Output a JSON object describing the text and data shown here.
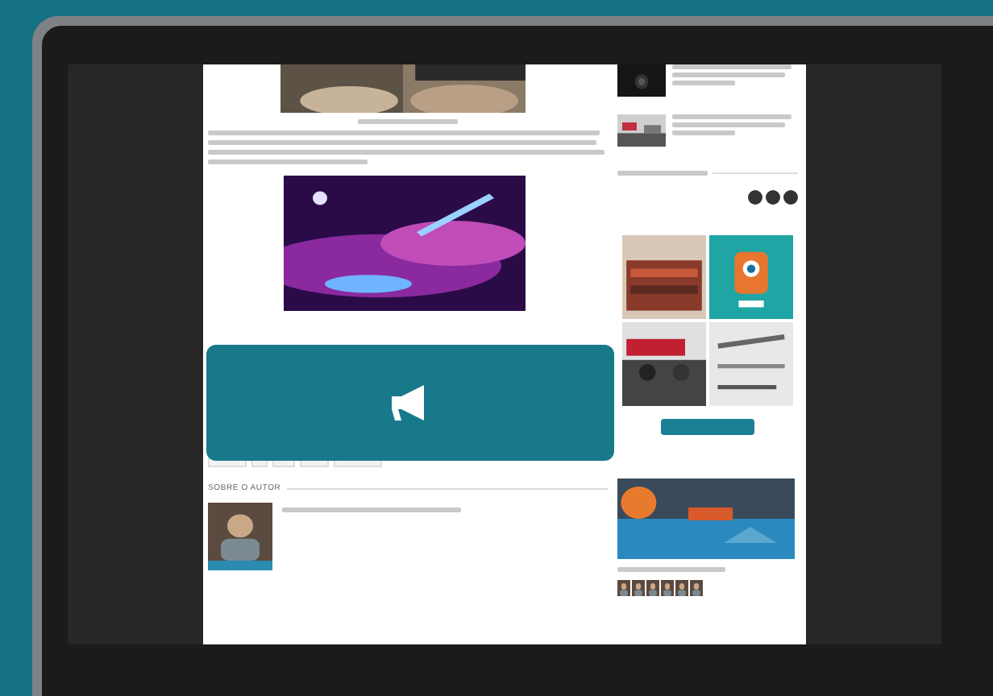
{
  "article": {
    "author_section_title": "SOBRE O AUTOR"
  },
  "overlay": {
    "kind": "megaphone"
  }
}
